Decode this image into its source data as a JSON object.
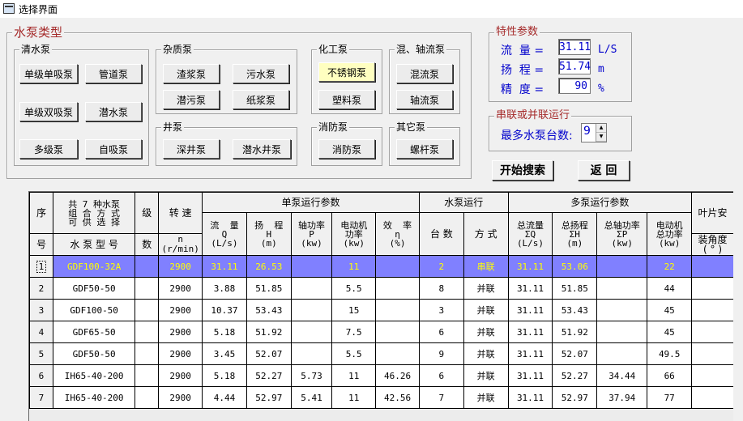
{
  "window": {
    "title": "选择界面"
  },
  "pump_types": {
    "title": "水泵类型",
    "clear_water": {
      "title": "清水泵",
      "buttons": [
        "单级单吸泵",
        "管道泵",
        "单级双吸泵",
        "潜水泵",
        "多级泵",
        "自吸泵"
      ]
    },
    "impurity": {
      "title": "杂质泵",
      "buttons": [
        "渣浆泵",
        "污水泵",
        "潜污泵",
        "纸浆泵"
      ]
    },
    "chemical": {
      "title": "化工泵",
      "buttons": [
        "不锈钢泵",
        "塑料泵"
      ],
      "selected": "不锈钢泵"
    },
    "mixed_axial": {
      "title": "混、轴流泵",
      "buttons": [
        "混流泵",
        "轴流泵"
      ]
    },
    "well": {
      "title": "井泵",
      "buttons": [
        "深井泵",
        "潜水井泵"
      ]
    },
    "fire": {
      "title": "消防泵",
      "buttons": [
        "消防泵"
      ]
    },
    "other": {
      "title": "其它泵",
      "buttons": [
        "螺杆泵"
      ]
    }
  },
  "params": {
    "title": "特性参数",
    "flow": {
      "label": "流  量 =",
      "value": "31.11",
      "unit": "L/S"
    },
    "head": {
      "label": "扬  程 =",
      "value": "51.74",
      "unit": "m"
    },
    "precision": {
      "label": "精  度 =",
      "value": "90",
      "unit": "%"
    }
  },
  "series_parallel": {
    "title": "串联或并联运行",
    "label": "最多水泵台数:",
    "value": "9"
  },
  "actions": {
    "search": "开始搜索",
    "back": "返  回"
  },
  "table": {
    "headers": {
      "seq_top": "序",
      "seq_bottom": "号",
      "combo": "共 7 种水泵\n组 合 方 式\n可 供 选 择",
      "model": "水 泵 型 号",
      "stage_top": "级",
      "stage_bottom": "数",
      "speed_top": "转 速",
      "speed_sym": "n",
      "speed_unit": "(r/min)",
      "single_group": "单泵运行参数",
      "flow": "流  量\nQ\n(L/s)",
      "head": "扬  程\nH\n(m)",
      "shaft": "轴功率\nP\n(kw)",
      "motor": "电动机\n功率\n(kw)",
      "eff": "效  率\nη\n(%)",
      "pump_op_group": "水泵运行",
      "count": "台  数",
      "mode": "方  式",
      "multi_group": "多泵运行参数",
      "total_flow": "总流量\nΣQ\n(L/s)",
      "total_head": "总扬程\nΣH\n(m)",
      "total_shaft": "总轴功率\nΣP\n(kw)",
      "total_motor": "电动机\n总功率\n(kw)",
      "blade_top": "叶片安",
      "blade_mid": "装角度",
      "blade_bottom": "( ° )"
    },
    "rows": [
      {
        "n": "1",
        "model": "GDF100-32A",
        "stages": "",
        "speed": "2900",
        "q": "31.11",
        "h": "26.53",
        "p": "",
        "motor": "11",
        "eff": "",
        "count": "2",
        "mode": "串联",
        "tq": "31.11",
        "th": "53.06",
        "tp": "",
        "tm": "22",
        "blade": ""
      },
      {
        "n": "2",
        "model": "GDF50-50",
        "stages": "",
        "speed": "2900",
        "q": "3.88",
        "h": "51.85",
        "p": "",
        "motor": "5.5",
        "eff": "",
        "count": "8",
        "mode": "并联",
        "tq": "31.11",
        "th": "51.85",
        "tp": "",
        "tm": "44",
        "blade": ""
      },
      {
        "n": "3",
        "model": "GDF100-50",
        "stages": "",
        "speed": "2900",
        "q": "10.37",
        "h": "53.43",
        "p": "",
        "motor": "15",
        "eff": "",
        "count": "3",
        "mode": "并联",
        "tq": "31.11",
        "th": "53.43",
        "tp": "",
        "tm": "45",
        "blade": ""
      },
      {
        "n": "4",
        "model": "GDF65-50",
        "stages": "",
        "speed": "2900",
        "q": "5.18",
        "h": "51.92",
        "p": "",
        "motor": "7.5",
        "eff": "",
        "count": "6",
        "mode": "并联",
        "tq": "31.11",
        "th": "51.92",
        "tp": "",
        "tm": "45",
        "blade": ""
      },
      {
        "n": "5",
        "model": "GDF50-50",
        "stages": "",
        "speed": "2900",
        "q": "3.45",
        "h": "52.07",
        "p": "",
        "motor": "5.5",
        "eff": "",
        "count": "9",
        "mode": "并联",
        "tq": "31.11",
        "th": "52.07",
        "tp": "",
        "tm": "49.5",
        "blade": ""
      },
      {
        "n": "6",
        "model": "IH65-40-200",
        "stages": "",
        "speed": "2900",
        "q": "5.18",
        "h": "52.27",
        "p": "5.73",
        "motor": "11",
        "eff": "46.26",
        "count": "6",
        "mode": "并联",
        "tq": "31.11",
        "th": "52.27",
        "tp": "34.44",
        "tm": "66",
        "blade": ""
      },
      {
        "n": "7",
        "model": "IH65-40-200",
        "stages": "",
        "speed": "2900",
        "q": "4.44",
        "h": "52.97",
        "p": "5.41",
        "motor": "11",
        "eff": "42.56",
        "count": "7",
        "mode": "并联",
        "tq": "31.11",
        "th": "52.97",
        "tp": "37.94",
        "tm": "77",
        "blade": ""
      }
    ],
    "selected_row": 0
  }
}
